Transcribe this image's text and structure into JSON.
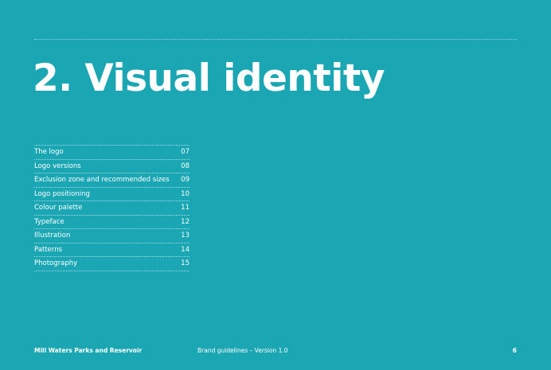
{
  "colors": {
    "background": "#1ba6b3",
    "text": "#ffffff"
  },
  "section": {
    "title": "2. Visual identity"
  },
  "toc": {
    "items": [
      {
        "label": "The logo",
        "page": "07"
      },
      {
        "label": "Logo versions",
        "page": "08"
      },
      {
        "label": "Exclusion zone and recommended sizes",
        "page": "09"
      },
      {
        "label": "Logo positioning",
        "page": "10"
      },
      {
        "label": "Colour palette",
        "page": "11"
      },
      {
        "label": "Typeface",
        "page": "12"
      },
      {
        "label": "Illustration",
        "page": "13"
      },
      {
        "label": "Patterns",
        "page": "14"
      },
      {
        "label": "Photography",
        "page": "15"
      }
    ]
  },
  "footer": {
    "organization": "Mill Waters Parks and Reservoir",
    "document": "Brand guidelines – Version 1.0",
    "page_number": "6"
  }
}
